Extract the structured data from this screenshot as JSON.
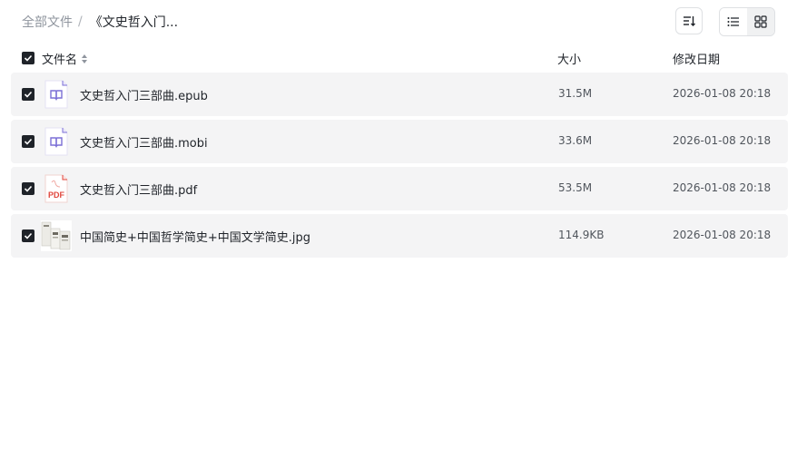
{
  "breadcrumb": {
    "root": "全部文件",
    "separator": "/",
    "current": "《文史哲入门..."
  },
  "toolbar": {
    "sort_icon": "sort-icon",
    "list_view_icon": "list-view-icon",
    "grid_view_icon": "grid-view-icon"
  },
  "table": {
    "headers": {
      "name": "文件名",
      "size": "大小",
      "date": "修改日期"
    },
    "files": [
      {
        "name": "文史哲入门三部曲.epub",
        "size": "31.5M",
        "date": "2026-01-08 20:18",
        "type": "ebook",
        "checked": true
      },
      {
        "name": "文史哲入门三部曲.mobi",
        "size": "33.6M",
        "date": "2026-01-08 20:18",
        "type": "ebook",
        "checked": true
      },
      {
        "name": "文史哲入门三部曲.pdf",
        "size": "53.5M",
        "date": "2026-01-08 20:18",
        "type": "pdf",
        "checked": true
      },
      {
        "name": "中国简史+中国哲学简史+中国文学简史.jpg",
        "size": "114.9KB",
        "date": "2026-01-08 20:18",
        "type": "image",
        "checked": true
      }
    ]
  },
  "icons": {
    "pdf_label": "PDF"
  },
  "colors": {
    "row_bg": "#f4f4f5",
    "checkbox": "#1f2329",
    "ebook_icon": "#7b6fd6",
    "pdf_icon": "#e0463c"
  }
}
